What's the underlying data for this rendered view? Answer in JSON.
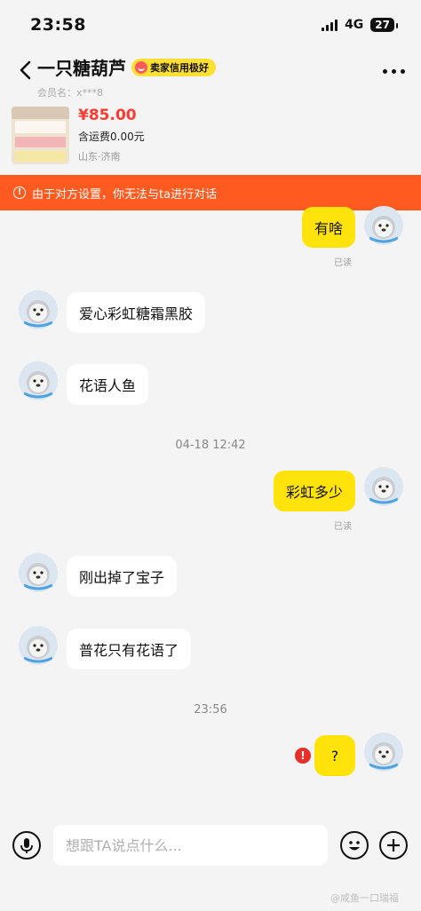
{
  "status_bar": {
    "time": "23:58",
    "network": "4G",
    "battery": "27"
  },
  "header": {
    "title": "一只糖葫芦",
    "badge": "卖家信用极好",
    "member": "会员名：x***8"
  },
  "product": {
    "price": "¥85.00",
    "shipping": "含运费0.00元",
    "location": "山东·济南"
  },
  "notice": {
    "text": "由于对方设置，你无法与ta进行对话",
    "icon": "!"
  },
  "messages": [
    {
      "text": "有啥",
      "read": "已读"
    },
    {
      "text": "爱心彩虹糖霜黑胶"
    },
    {
      "text": "花语人鱼"
    },
    {
      "time": "04-18 12:42"
    },
    {
      "text": "彩虹多少",
      "read": "已读"
    },
    {
      "text": "刚出掉了宝子"
    },
    {
      "text": "普花只有花语了"
    },
    {
      "time": "23:56"
    },
    {
      "text": "?",
      "error": "!"
    }
  ],
  "input": {
    "placeholder": "想跟TA说点什么..."
  },
  "watermark": "@咸鱼一口瑞福",
  "colors": {
    "accent_yellow": "#ffe30a",
    "notice_orange": "#ff5a1f",
    "price_red": "#ff3b30",
    "error_red": "#e6302a"
  }
}
